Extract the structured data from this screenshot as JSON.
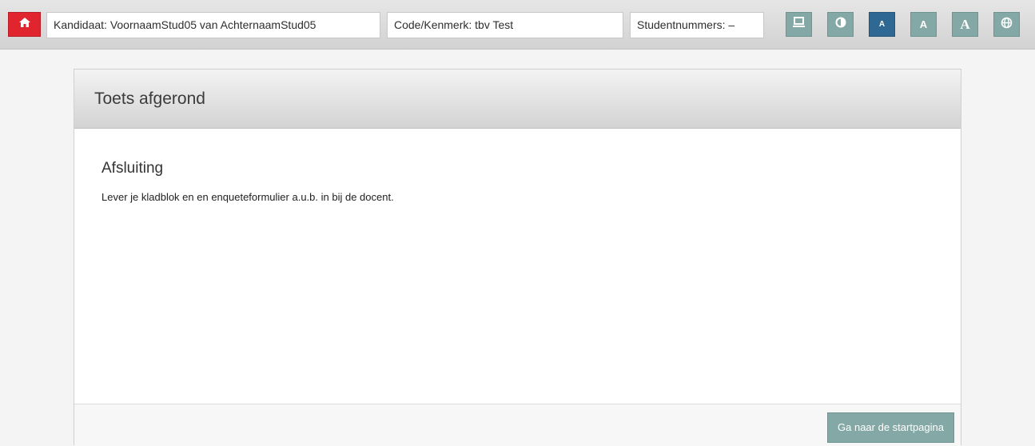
{
  "topbar": {
    "home_icon": "home-icon",
    "candidate": "Kandidaat: VoornaamStud05 van AchternaamStud05",
    "code": "Code/Kenmerk: tbv Test",
    "student_numbers": "Studentnummers: –",
    "tools": [
      {
        "name": "screen-icon",
        "label": ""
      },
      {
        "name": "contrast-icon",
        "label": ""
      },
      {
        "name": "font-small-icon",
        "label": "A"
      },
      {
        "name": "font-medium-icon",
        "label": "A"
      },
      {
        "name": "font-large-icon",
        "label": "A"
      },
      {
        "name": "globe-icon",
        "label": ""
      }
    ],
    "active_font_size": "small"
  },
  "panel": {
    "title": "Toets afgerond",
    "section_title": "Afsluiting",
    "section_text": "Lever je kladblok en en enqueteformulier a.u.b. in bij de docent.",
    "button_label": "Ga naar de startpagina"
  },
  "colors": {
    "home_red": "#e0252f",
    "tool_teal": "#84a8a5",
    "tool_active": "#2f6893"
  }
}
